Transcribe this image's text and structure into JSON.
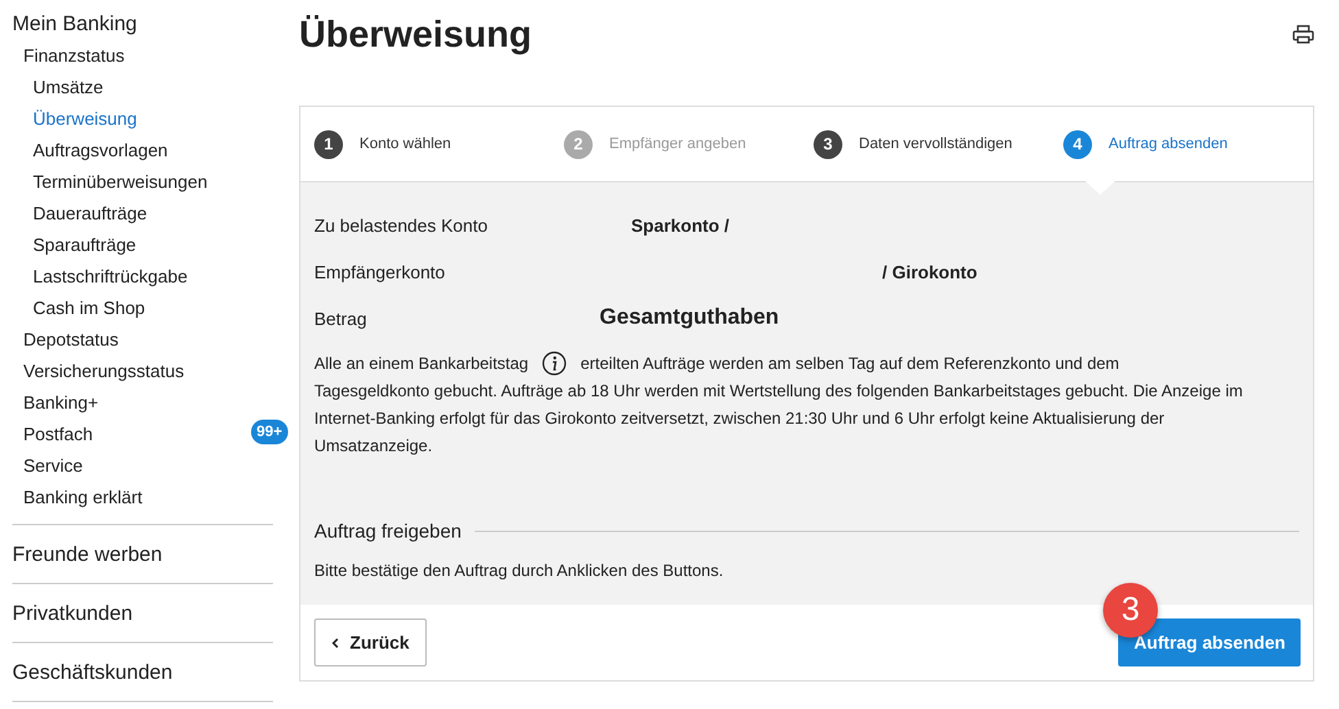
{
  "sidebar": {
    "items": [
      {
        "label": "Mein Banking",
        "selected": false,
        "children": [
          {
            "label": "Finanzstatus",
            "selected": false,
            "children": [
              {
                "label": "Umsätze",
                "selected": false
              },
              {
                "label": "Überweisung",
                "selected": true
              },
              {
                "label": "Auftragsvorlagen",
                "selected": false
              },
              {
                "label": "Terminüberweisungen",
                "selected": false
              },
              {
                "label": "Daueraufträge",
                "selected": false
              },
              {
                "label": "Sparaufträge",
                "selected": false
              },
              {
                "label": "Lastschriftrückgabe",
                "selected": false
              },
              {
                "label": "Cash im Shop",
                "selected": false
              }
            ]
          },
          {
            "label": "Depotstatus",
            "selected": false
          },
          {
            "label": "Versicherungsstatus",
            "selected": false
          },
          {
            "label": "Banking+",
            "selected": false
          },
          {
            "label": "Postfach",
            "selected": false,
            "badge": "99+"
          },
          {
            "label": "Service",
            "selected": false
          },
          {
            "label": "Banking erklärt",
            "selected": false
          }
        ]
      },
      {
        "label": "Freunde werben",
        "selected": false
      },
      {
        "label": "Privatkunden",
        "selected": false
      },
      {
        "label": "Geschäftskunden",
        "selected": false
      }
    ]
  },
  "page_title": "Überweisung",
  "steps": [
    {
      "number": "1",
      "label": "Konto wählen",
      "selected": false,
      "disabled": false
    },
    {
      "number": "2",
      "label": "Empfänger angeben",
      "selected": false,
      "disabled": true
    },
    {
      "number": "3",
      "label": "Daten vervollständigen",
      "selected": false,
      "disabled": false
    },
    {
      "number": "4",
      "label": "Auftrag absenden",
      "selected": true,
      "disabled": false
    }
  ],
  "details": [
    {
      "label": "Zu belastendes Konto",
      "value": "Sparkonto /",
      "kind": "account"
    },
    {
      "label": "Empfängerkonto",
      "value": "/ Girokonto",
      "kind": "recipient"
    },
    {
      "label": "Betrag",
      "value": "Gesamtguthaben",
      "kind": "amount"
    }
  ],
  "notice": {
    "before": "Alle an einem Bankarbeitstag",
    "after": "erteilten Aufträge werden am selben Tag auf dem Referenzkonto und dem",
    "continuation": "Tagesgeldkonto gebucht. Aufträge ab 18 Uhr werden mit Wertstellung des folgenden Bankarbeitstages gebucht. Die Anzeige im Internet-Banking erfolgt für das Girokonto zeitversetzt, zwischen 21:30 Uhr und 6 Uhr erfolgt keine Aktualisierung der Umsatzanzeige."
  },
  "release": {
    "heading": "Auftrag freigeben",
    "text": "Bitte bestätige den Auftrag durch Anklicken des Buttons."
  },
  "buttons": {
    "back": "Zurück",
    "submit": "Auftrag absenden"
  },
  "annotation": {
    "label": "3"
  }
}
